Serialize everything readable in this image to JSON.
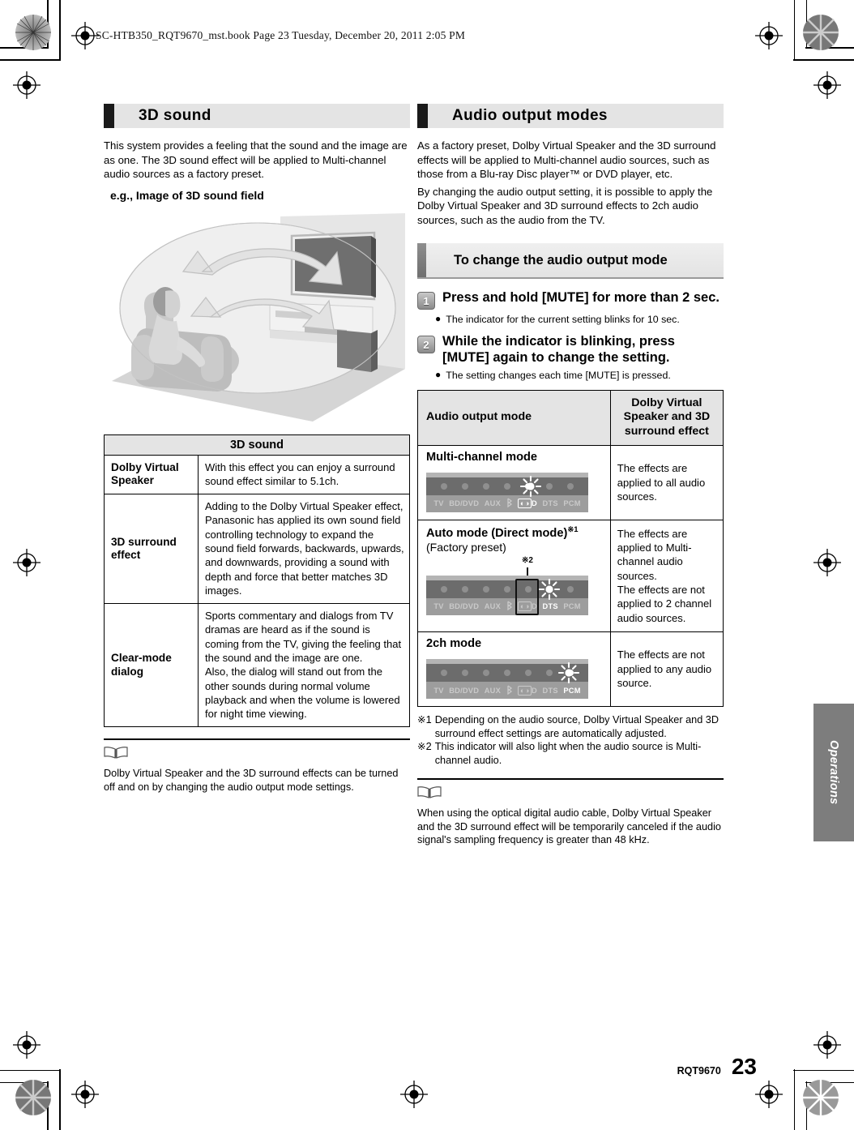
{
  "print_slug": "SC-HTB350_RQT9670_mst.book  Page 23  Tuesday, December 20, 2011  2:05 PM",
  "left_column": {
    "section_title": "3D sound",
    "intro": "This system provides a feeling that the sound and the image are as one. The 3D sound effect will be applied to Multi-channel audio sources as a factory preset.",
    "figure_label": "e.g., Image of 3D sound field",
    "table": {
      "title": "3D sound",
      "rows": [
        {
          "name": "Dolby Virtual Speaker",
          "description": "With this effect you can enjoy a surround sound effect similar to 5.1ch."
        },
        {
          "name": "3D surround effect",
          "description": "Adding to the Dolby Virtual Speaker effect, Panasonic has applied its own sound field controlling technology to expand the sound field forwards, backwards, upwards, and downwards, providing a sound with depth and force that better matches 3D images."
        },
        {
          "name": "Clear-mode dialog",
          "description": "Sports commentary and dialogs from TV dramas are heard as if the sound is coming from the TV, giving the feeling that the sound and the image are one.\nAlso, the dialog will stand out from the other sounds during normal volume playback and when the volume is lowered for night time viewing."
        }
      ]
    },
    "note": "Dolby Virtual Speaker and the 3D surround effects can be turned off and on by changing the audio output mode settings."
  },
  "right_column": {
    "section_title": "Audio output modes",
    "intro_1": "As a factory preset, Dolby Virtual Speaker and the 3D surround effects will be applied to Multi-channel audio sources, such as those from a Blu-ray Disc player™ or DVD player, etc.",
    "intro_2": "By changing the audio output setting, it is possible to apply the Dolby Virtual Speaker and 3D surround effects to 2ch audio sources, such as the audio from the TV.",
    "sub_section_title": "To change the audio output mode",
    "steps": [
      {
        "number": "1",
        "text": "Press and hold [MUTE] for more than 2 sec.",
        "bullet": "The indicator for the current setting blinks for 10 sec."
      },
      {
        "number": "2",
        "text": "While the indicator is blinking, press [MUTE] again to change the setting.",
        "bullet": "The setting changes each time [MUTE] is pressed."
      }
    ],
    "table": {
      "header_mode": "Audio output mode",
      "header_effect": "Dolby Virtual Speaker and 3D surround effect",
      "panel_indicators": [
        "TV",
        "BD/DVD",
        "AUX",
        "bluetooth-icon",
        "DOLBY-D",
        "DTS",
        "PCM"
      ],
      "rows": [
        {
          "name": "Multi-channel mode",
          "name_sup": "",
          "subtitle": "",
          "lit_indicator": "DOLBY-D",
          "marked_indicator": "",
          "marker_label": "",
          "effect": "The effects are applied to all audio sources."
        },
        {
          "name": "Auto mode (Direct mode)",
          "name_sup": "※1",
          "subtitle": "(Factory preset)",
          "lit_indicator": "DTS",
          "marked_indicator": "DOLBY-D",
          "marker_label": "※2",
          "effect": "The effects are applied to Multi-channel audio sources.\nThe effects are not applied to 2 channel audio sources."
        },
        {
          "name": "2ch mode",
          "name_sup": "",
          "subtitle": "",
          "lit_indicator": "PCM",
          "marked_indicator": "",
          "marker_label": "",
          "effect": "The effects are not applied to any audio source."
        }
      ]
    },
    "footnotes": [
      {
        "mark": "※1",
        "text": "Depending on the audio source, Dolby Virtual Speaker and 3D surround effect settings are automatically adjusted."
      },
      {
        "mark": "※2",
        "text": "This indicator will also light when the audio source is Multi-channel audio."
      }
    ],
    "note": "When using the optical digital audio cable, Dolby Virtual Speaker and the 3D surround effect will be temporarily canceled if the audio signal's sampling frequency is greater than 48 kHz."
  },
  "side_tab": "Operations",
  "footer": {
    "code": "RQT9670",
    "page": "23"
  }
}
